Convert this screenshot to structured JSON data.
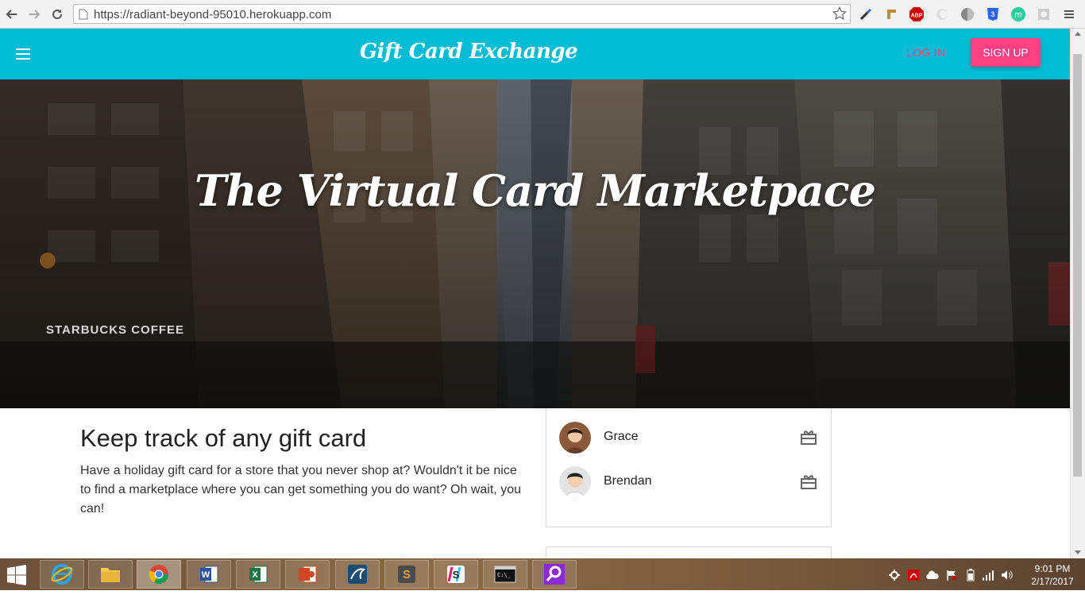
{
  "browser": {
    "url": "https://radiant-beyond-95010.herokuapp.com",
    "extensions": [
      "eyedropper-icon",
      "ruler-icon",
      "adblock-icon",
      "ghost-extension-icon",
      "circle-extension-icon",
      "css3-icon",
      "m-extension-icon",
      "settings-extension-icon"
    ],
    "abp_label": "ABP",
    "m_label": "m"
  },
  "header": {
    "brand": "Gift Card Exchange",
    "login_label": "LOG IN",
    "signup_label": "SIGN UP",
    "color": "#00bcd4",
    "accent": "#ff4081"
  },
  "hero": {
    "title": "The Virtual Card Marketpace",
    "sign_text": "STARBUCKS COFFEE"
  },
  "intro": {
    "title": "Keep track of any gift card",
    "text": "Have a holiday gift card for a store that you never shop at? Wouldn't it be nice to find a marketplace where you can get something you do want? Oh wait, you can!"
  },
  "users": [
    {
      "name": "Grace",
      "icon": "gift-card-icon"
    },
    {
      "name": "Brendan",
      "icon": "gift-card-icon"
    }
  ],
  "taskbar": {
    "apps": [
      "internet-explorer-icon",
      "file-explorer-icon",
      "chrome-icon",
      "word-icon",
      "excel-icon",
      "powerpoint-icon",
      "mysql-workbench-icon",
      "sublime-text-icon",
      "slack-icon",
      "command-prompt-icon",
      "search-app-icon"
    ],
    "time": "9:01 PM",
    "date": "2/17/2017"
  }
}
